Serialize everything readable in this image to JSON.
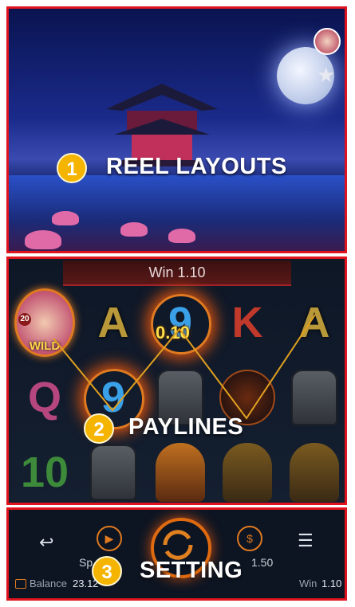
{
  "callouts": [
    {
      "number": "1",
      "label": "REEL LAYOUTS"
    },
    {
      "number": "2",
      "label": "PAYLINES"
    },
    {
      "number": "3",
      "label": "SETTING"
    }
  ],
  "reels": {
    "win_bar": "Win 1.10",
    "wild_label": "WILD",
    "wild_badge": "20",
    "multiplier": "0.10",
    "rows": [
      [
        "wild",
        "A",
        "9",
        "K",
        "A"
      ],
      [
        "Q",
        "9",
        "soldier",
        "orb",
        "soldier"
      ],
      [
        "10",
        "soldier",
        "hero",
        "brute",
        "brute"
      ]
    ]
  },
  "settings": {
    "spin_partial": "Sp",
    "bet_partial": "1.50",
    "balance_label": "Balance",
    "balance_value": "23.12",
    "win_label": "Win",
    "win_value": "1.10"
  },
  "colors": {
    "frame": "#e0141e",
    "badge": "#f4b400",
    "accent": "#e06a10"
  }
}
